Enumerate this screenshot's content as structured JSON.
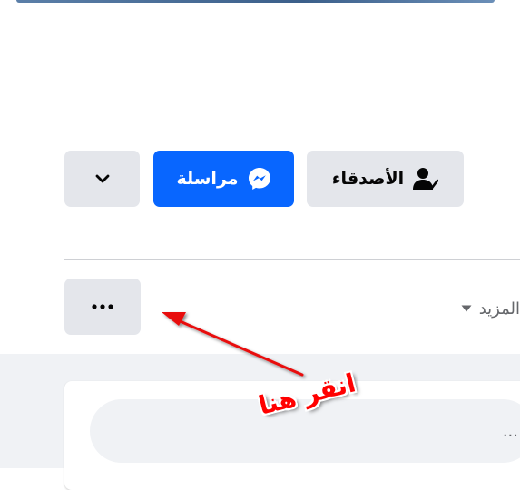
{
  "profile_actions": {
    "friends_label": "الأصدقاء",
    "friends_icon": "person-check-icon",
    "message_label": "مراسلة",
    "message_icon": "messenger-icon",
    "dropdown_icon": "chevron-down-icon"
  },
  "tabs_row": {
    "more_label": "المزيد",
    "more_icon": "caret-down-icon",
    "options_icon": "three-dots-icon"
  },
  "composer": {
    "placeholder": "..."
  },
  "annotation": {
    "text": "انقر هنا",
    "color": "#ff0000"
  },
  "colors": {
    "accent": "#0866ff",
    "button_grey": "#e4e6eb"
  }
}
